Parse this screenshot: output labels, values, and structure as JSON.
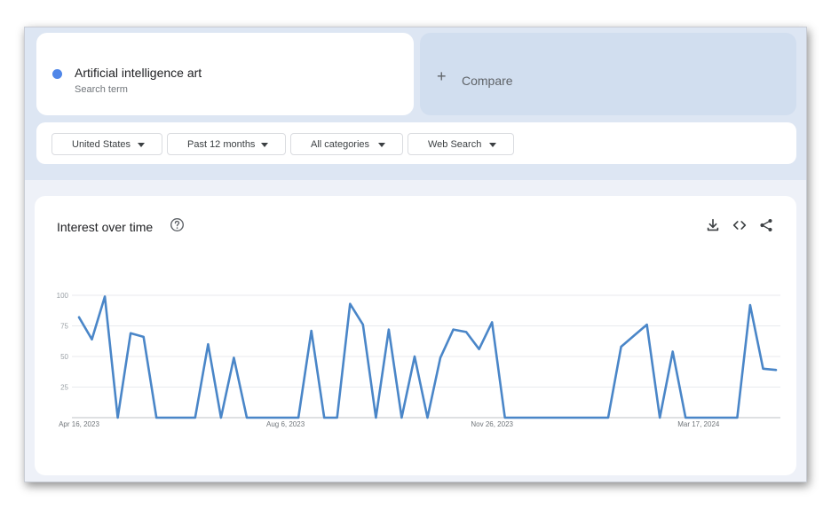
{
  "search_term": {
    "name": "Artificial intelligence art",
    "subtitle": "Search term",
    "color": "#4f86e8"
  },
  "compare": {
    "icon": "plus-icon",
    "label": "Compare"
  },
  "filters": {
    "geo": "United States",
    "time": "Past 12 months",
    "category": "All categories",
    "property": "Web Search"
  },
  "interest_panel": {
    "title": "Interest over time",
    "icons": [
      "help-icon",
      "download-icon",
      "embed-icon",
      "share-icon"
    ]
  },
  "chart_data": {
    "type": "line",
    "title": "Interest over time",
    "xlabel": "",
    "ylabel": "",
    "ylim": [
      0,
      100
    ],
    "yticks": [
      25,
      50,
      75,
      100
    ],
    "x_tick_labels": [
      "Apr 16, 2023",
      "Aug 6, 2023",
      "Nov 26, 2023",
      "Mar 17, 2024"
    ],
    "x_tick_indices": [
      0,
      16,
      32,
      48
    ],
    "grid": true,
    "line_color": "#4a86c8",
    "series": [
      {
        "values": [
          82,
          64,
          99,
          0,
          69,
          66,
          0,
          0,
          0,
          0,
          60,
          0,
          49,
          0,
          0,
          0,
          0,
          0,
          71,
          0,
          0,
          93,
          76,
          0,
          72,
          0,
          50,
          0,
          49,
          72,
          70,
          56,
          78,
          0,
          0,
          0,
          0,
          0,
          0,
          0,
          0,
          0,
          58,
          67,
          76,
          0,
          54,
          0,
          0,
          0,
          0,
          0,
          92,
          40,
          39
        ]
      }
    ]
  }
}
